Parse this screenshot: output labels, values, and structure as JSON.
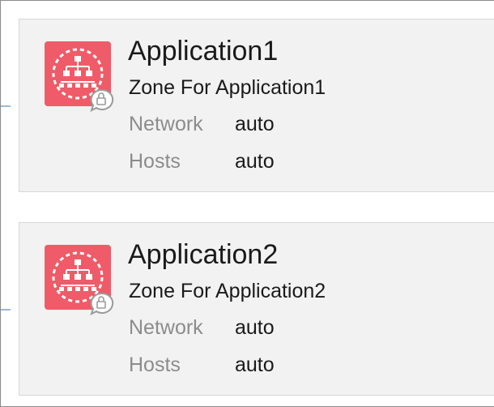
{
  "colors": {
    "icon_background": "#ef5b68",
    "card_background": "#f2f2f2",
    "label_text": "#8c8c8c",
    "value_text": "#1a1a1a"
  },
  "icons": {
    "zone": "zone-network-icon",
    "badge": "chat-lock-badge-icon"
  },
  "zones": [
    {
      "app_name": "Application1",
      "zone_name": "Zone For Application1",
      "network_label": "Network",
      "network_value": "auto",
      "hosts_label": "Hosts",
      "hosts_value": "auto"
    },
    {
      "app_name": "Application2",
      "zone_name": "Zone For Application2",
      "network_label": "Network",
      "network_value": "auto",
      "hosts_label": "Hosts",
      "hosts_value": "auto"
    }
  ]
}
